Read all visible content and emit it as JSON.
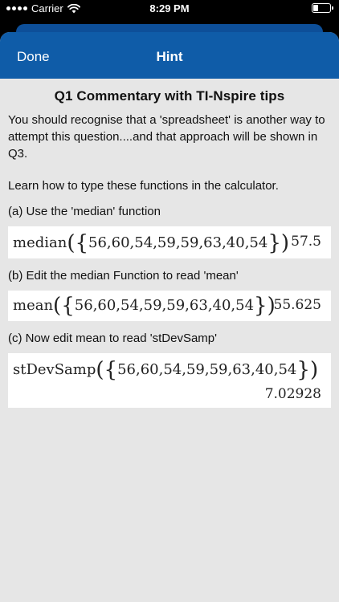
{
  "status_bar": {
    "carrier": "Carrier",
    "time": "8:29 PM",
    "battery_level": 0.3
  },
  "nav": {
    "done_label": "Done",
    "title": "Hint"
  },
  "content": {
    "heading": "Q1 Commentary with TI-Nspire tips",
    "intro": "You should recognise that a 'spreadsheet' is another way to attempt this question....and that approach will be shown in Q3.",
    "learn": "Learn how to type these functions in the calculator.",
    "steps": [
      {
        "label": "(a) Use the 'median' function",
        "func": "median",
        "args": "56,60,54,59,59,63,40,54",
        "result": "57.5"
      },
      {
        "label": "(b) Edit the median Function to read 'mean'",
        "func": "mean",
        "args": "56,60,54,59,59,63,40,54",
        "result": "55.625"
      },
      {
        "label": "(c) Now edit mean to read 'stDevSamp'",
        "func": "stDevSamp",
        "args": "56,60,54,59,59,63,40,54",
        "result": "7.02928"
      }
    ]
  },
  "colors": {
    "nav_background": "#0f5ca8",
    "sheet_background": "#e6e6e6"
  },
  "icons": [
    "signal-dots-icon",
    "wifi-icon",
    "battery-icon"
  ]
}
